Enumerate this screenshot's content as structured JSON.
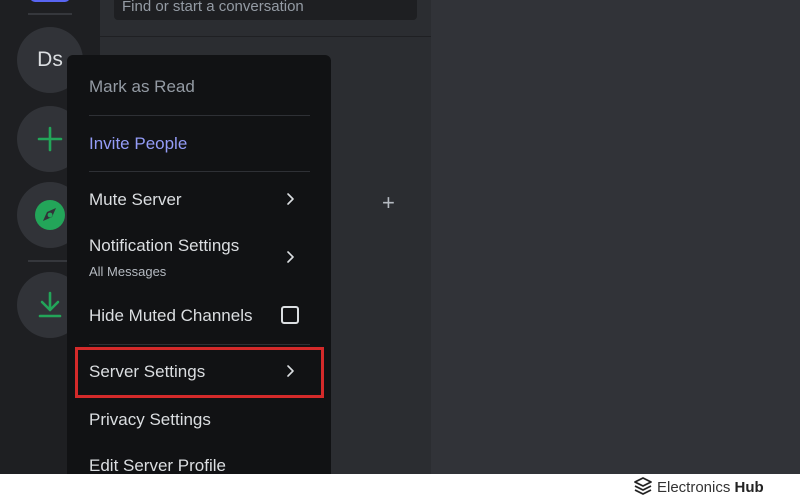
{
  "servers": {
    "ds_label": "Ds"
  },
  "dm_panel": {
    "search_text": "Find or start a conversation",
    "plus_label": "+"
  },
  "context_menu": {
    "mark_as_read": "Mark as Read",
    "invite_people": "Invite People",
    "mute_server": "Mute Server",
    "notification_settings": "Notification Settings",
    "notification_sub": "All Messages",
    "hide_muted": "Hide Muted Channels",
    "hide_muted_checked": false,
    "server_settings": "Server Settings",
    "privacy_settings": "Privacy Settings",
    "edit_profile": "Edit Server Profile"
  },
  "watermark": {
    "brand_light": "Electronics",
    "brand_bold": "Hub"
  },
  "colors": {
    "accent": "#949cf7",
    "green": "#23a559",
    "highlight": "#d42a2a"
  }
}
